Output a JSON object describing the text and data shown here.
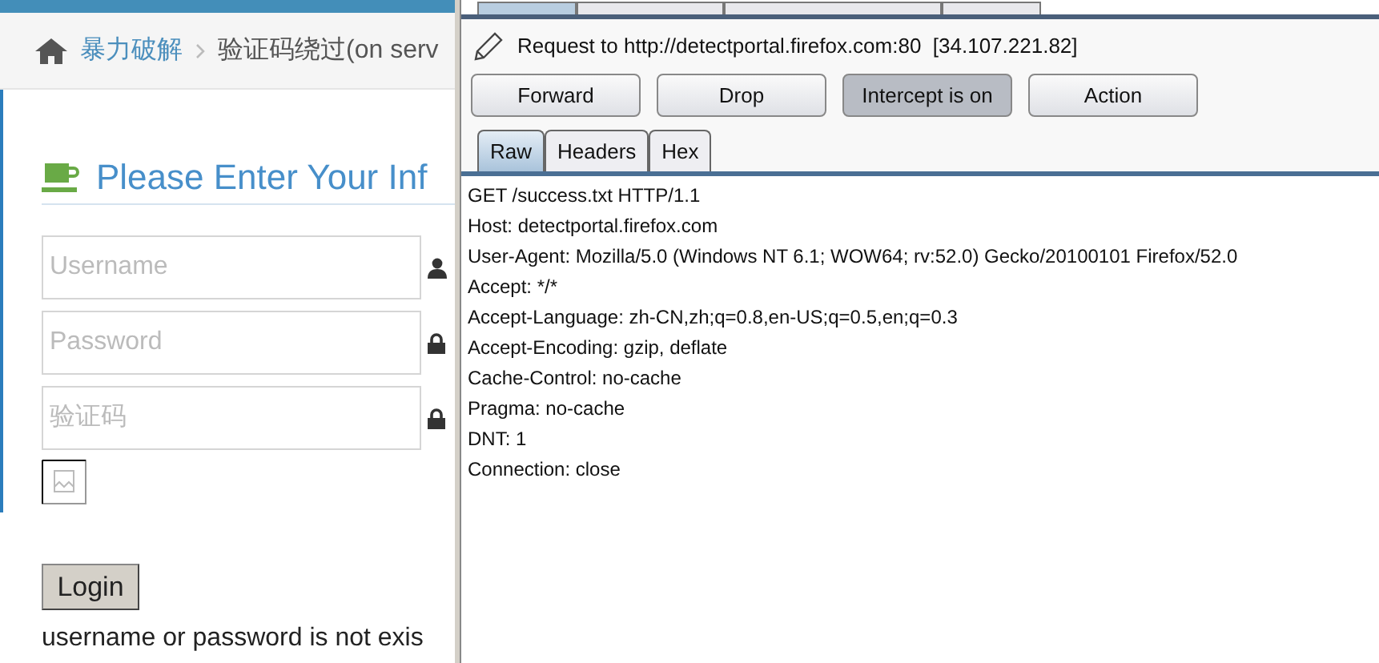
{
  "browser_page": {
    "breadcrumb": [
      {
        "label": "暴力破解",
        "kind": "link"
      },
      {
        "label": "验证码绕过(on serv",
        "kind": "current"
      }
    ],
    "heading": "Please Enter Your Inf",
    "fields": [
      {
        "placeholder": "Username",
        "kind": "user"
      },
      {
        "placeholder": "Password",
        "kind": "lock"
      },
      {
        "placeholder": "验证码",
        "kind": "lock"
      }
    ],
    "login_button": "Login",
    "message": "username or password is not exis"
  },
  "intercept": {
    "upper_tabs": [
      {
        "selected": true
      },
      {
        "selected": false
      },
      {
        "selected": false
      },
      {
        "selected": false
      }
    ],
    "request_line": "Request to http://detectportal.firefox.com:80  [34.107.221.82]",
    "buttons": [
      {
        "label": "Forward",
        "pressed": false
      },
      {
        "label": "Drop",
        "pressed": false
      },
      {
        "label": "Intercept is on",
        "pressed": true
      },
      {
        "label": "Action",
        "pressed": false
      }
    ],
    "tabs": [
      {
        "label": "Raw",
        "selected": true
      },
      {
        "label": "Headers",
        "selected": false
      },
      {
        "label": "Hex",
        "selected": false
      }
    ],
    "body_lines": [
      "GET /success.txt HTTP/1.1",
      "Host: detectportal.firefox.com",
      "User-Agent: Mozilla/5.0 (Windows NT 6.1; WOW64; rv:52.0) Gecko/20100101 Firefox/52.0",
      "Accept: */*",
      "Accept-Language: zh-CN,zh;q=0.8,en-US;q=0.5,en;q=0.3",
      "Accept-Encoding: gzip, deflate",
      "Cache-Control: no-cache",
      "Pragma: no-cache",
      "DNT: 1",
      "Connection: close"
    ]
  }
}
